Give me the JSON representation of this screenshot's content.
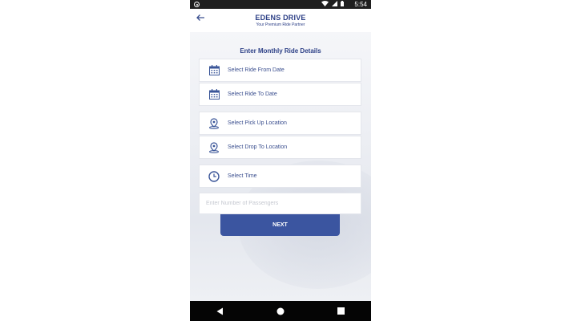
{
  "status_bar": {
    "time": "5:54"
  },
  "header": {
    "title": "EDENS DRIVE",
    "tagline": "Your Premium Ride Partner"
  },
  "form": {
    "title": "Enter Monthly Ride Details",
    "fields": [
      {
        "label": "Select Ride From Date",
        "icon": "calendar-icon"
      },
      {
        "label": "Select Ride To Date",
        "icon": "calendar-icon"
      },
      {
        "label": "Select Pick Up Location",
        "icon": "location-pin-icon"
      },
      {
        "label": "Select Drop To Location",
        "icon": "location-pin-icon"
      },
      {
        "label": "Select Time",
        "icon": "clock-icon"
      }
    ],
    "passengers_placeholder": "Enter Number of Passengers",
    "next_label": "NEXT"
  },
  "colors": {
    "brand": "#2c3f86",
    "button": "#3b55a0",
    "icon": "#3a5598"
  }
}
